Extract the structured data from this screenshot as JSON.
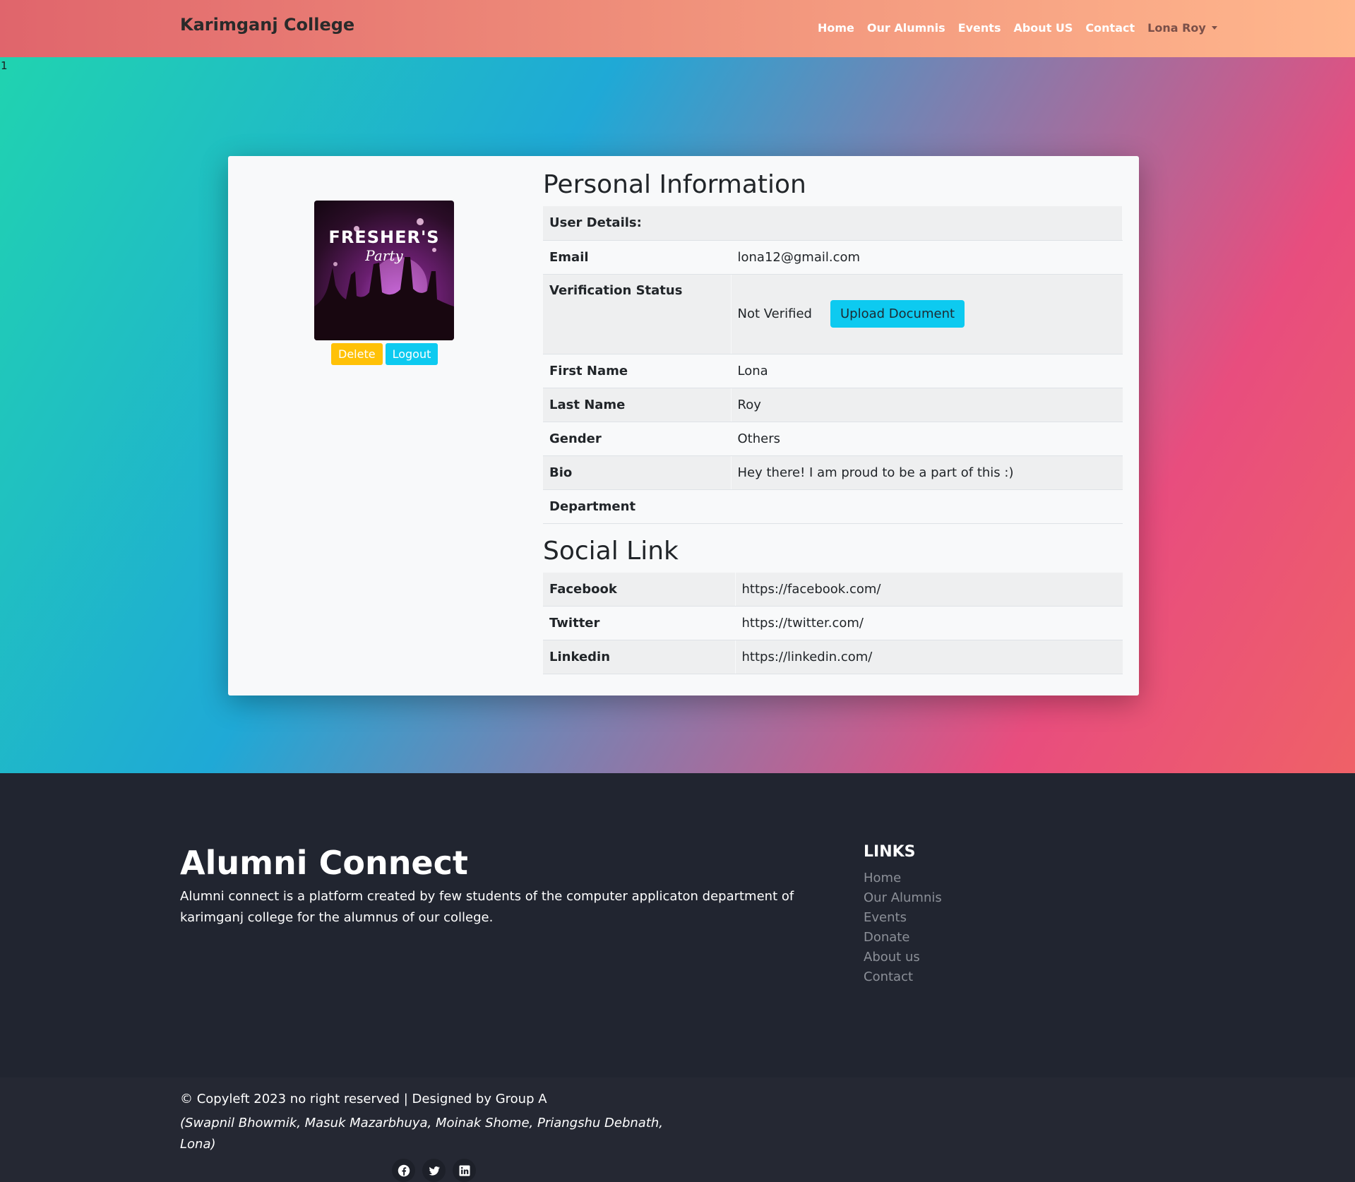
{
  "nav": {
    "brand": "Karimganj College",
    "links": [
      "Home",
      "Our Alumnis",
      "Events",
      "About US",
      "Contact"
    ],
    "user": "Lona Roy"
  },
  "stray_text": "1",
  "profile": {
    "image_text_line1": "FRESHER'S",
    "image_text_line2": "Party",
    "delete_label": "Delete",
    "logout_label": "Logout"
  },
  "personal": {
    "title": "Personal Information",
    "section_header": "User Details:",
    "email_label": "Email",
    "email": "lona12@gmail.com",
    "verification_label": "Verification Status",
    "verification_status": "Not Verified",
    "upload_label": "Upload Document",
    "first_name_label": "First Name",
    "first_name": "Lona",
    "last_name_label": "Last Name",
    "last_name": "Roy",
    "gender_label": "Gender",
    "gender": "Others",
    "bio_label": "Bio",
    "bio": "Hey there! I am proud to be a part of this :)",
    "department_label": "Department",
    "department": ""
  },
  "social": {
    "title": "Social Link",
    "facebook_label": "Facebook",
    "facebook": "https://facebook.com/",
    "twitter_label": "Twitter",
    "twitter": "https://twitter.com/",
    "linkedin_label": "Linkedin",
    "linkedin": "https://linkedin.com/"
  },
  "footer": {
    "title": "Alumni Connect",
    "description": "Alumni connect is a platform created by few students of the computer applicaton department of karimganj college for the alumnus of our college.",
    "links_heading": "LINKS",
    "links": [
      "Home",
      "Our Alumnis",
      "Events",
      "Donate",
      "About us",
      "Contact"
    ],
    "copyright": "© Copyleft 2023 no right reserved | Designed by Group A",
    "authors": "(Swapnil Bhowmik, Masuk Mazarbhuya, Moinak Shome, Priangshu Debnath, Lona)",
    "social_icons": [
      "facebook-icon",
      "twitter-icon",
      "linkedin-icon"
    ]
  },
  "colors": {
    "nav_start": "#e0656c",
    "nav_end": "#ffb78d",
    "warning": "#ffc107",
    "info": "#0dcaf0",
    "footer_bg": "#212530"
  }
}
